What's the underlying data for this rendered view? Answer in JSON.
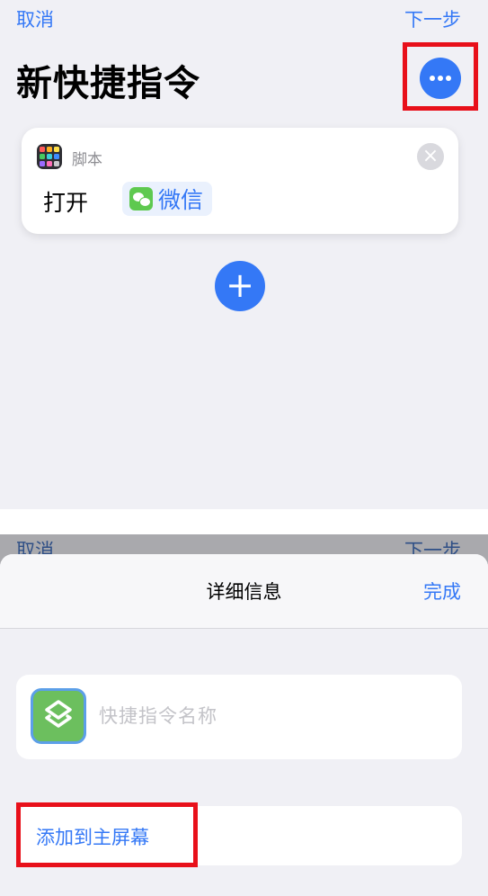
{
  "top": {
    "cancel_label": "取消",
    "next_label": "下一步",
    "title": "新快捷指令",
    "more_icon": "ellipsis-icon",
    "action": {
      "category_icon": "scripting-grid-icon",
      "category": "脚本",
      "verb": "打开",
      "app_icon": "wechat-icon",
      "app_name": "微信",
      "remove_icon": "close-circle-icon"
    },
    "add_icon": "plus-icon"
  },
  "bottom": {
    "ghost_cancel": "取消",
    "ghost_next": "下一步",
    "sheet_title": "详细信息",
    "done_label": "完成",
    "shortcut_icon": "shortcuts-layers-icon",
    "name_placeholder": "快捷指令名称",
    "add_home_label": "添加到主屏幕"
  },
  "colors": {
    "accent": "#3478f6",
    "highlight": "#e8101a",
    "wechat_green": "#5ec94f",
    "shortcut_green": "#6cbf5e"
  }
}
